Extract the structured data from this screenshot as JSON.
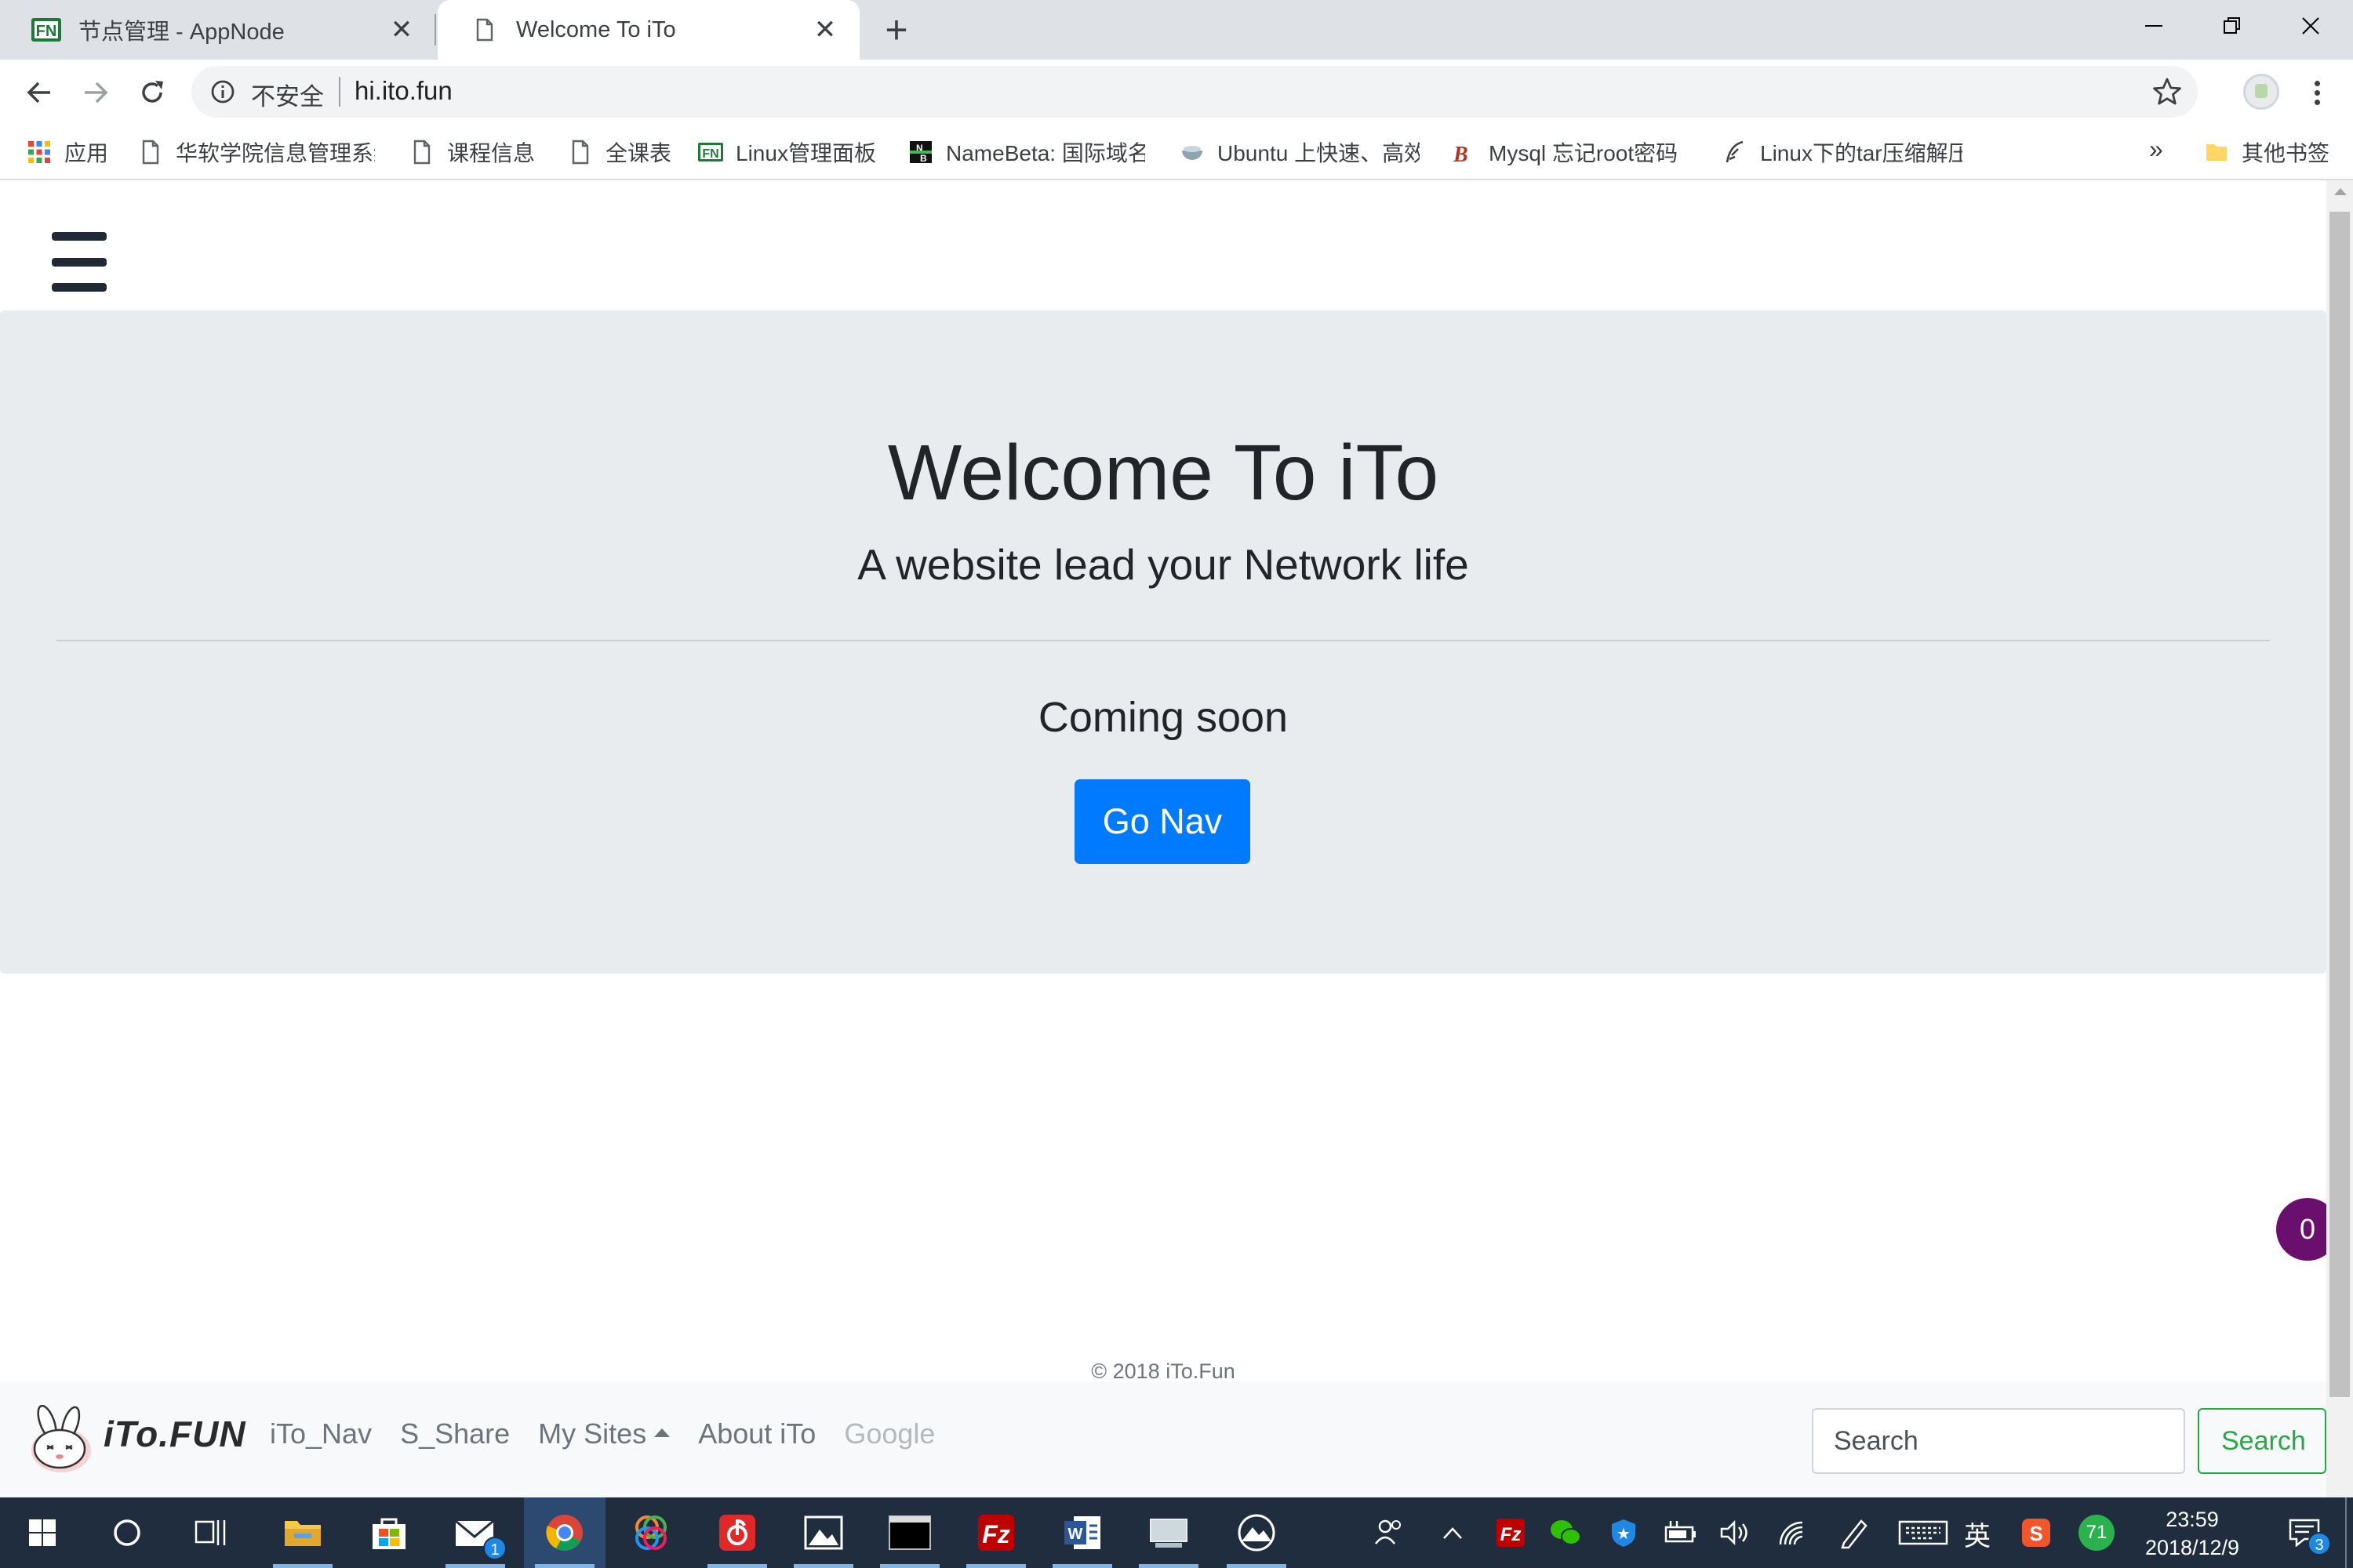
{
  "browser": {
    "tabs": [
      {
        "title": "节点管理 - AppNode",
        "active": false
      },
      {
        "title": "Welcome To iTo",
        "active": true
      }
    ],
    "security_label": "不安全",
    "url": "hi.ito.fun",
    "bookmarks": [
      {
        "label": "应用",
        "icon": "apps-grid-icon"
      },
      {
        "label": "华软学院信息管理系统",
        "icon": "page-icon"
      },
      {
        "label": "课程信息",
        "icon": "page-icon"
      },
      {
        "label": "全课表",
        "icon": "page-icon"
      },
      {
        "label": "Linux管理面板",
        "icon": "appnode-icon"
      },
      {
        "label": "NameBeta: 国际域名",
        "icon": "namebeta-icon"
      },
      {
        "label": "Ubuntu 上快速、高效",
        "icon": "bowl-icon"
      },
      {
        "label": "Mysql 忘记root密码",
        "icon": "b-logo-icon"
      },
      {
        "label": "Linux下的tar压缩解压",
        "icon": "feather-icon"
      }
    ],
    "bookmarks_overflow": "»",
    "other_bookmarks": "其他书签"
  },
  "page": {
    "title": "Welcome To iTo",
    "lead": "A website lead your Network life",
    "coming_soon": "Coming soon",
    "cta_label": "Go Nav",
    "cta_color": "#007bff",
    "copyright": "© 2018 iTo.Fun",
    "brand_text": "iTo.FUN",
    "nav_links": [
      {
        "label": "iTo_Nav",
        "dimmed": false
      },
      {
        "label": "S_Share",
        "dimmed": false
      },
      {
        "label": "My Sites",
        "dimmed": false,
        "dropdown": true
      },
      {
        "label": "About iTo",
        "dimmed": false
      },
      {
        "label": "Google",
        "dimmed": true
      }
    ],
    "search_placeholder": "Search",
    "search_button": "Search",
    "search_button_color": "#28a745",
    "floating_badge": "0"
  },
  "taskbar": {
    "mail_badge": "1",
    "security_score": "71",
    "ime": "英",
    "time": "23:59",
    "date": "2018/12/9",
    "notifications": "3"
  }
}
